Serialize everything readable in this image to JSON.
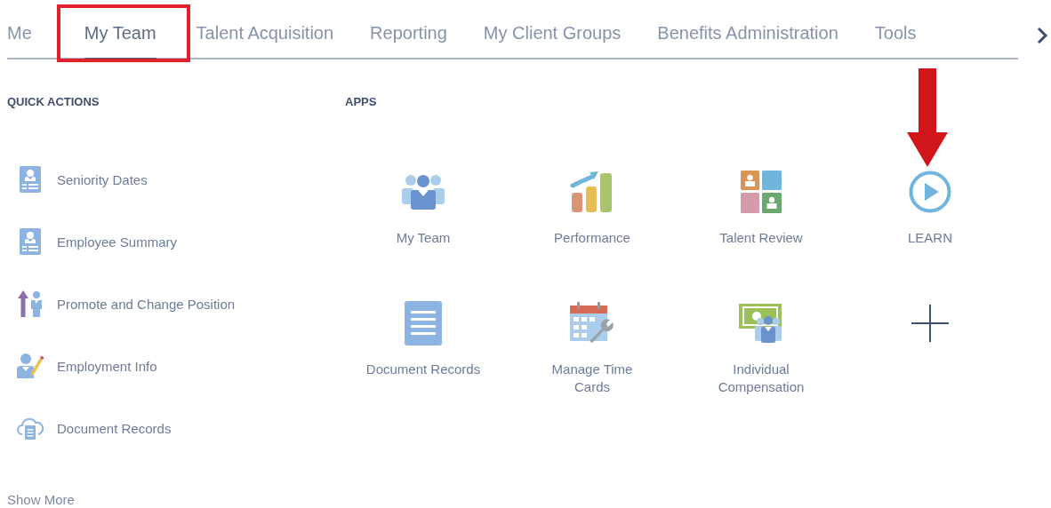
{
  "tabs": [
    {
      "label": "Me",
      "selected": false
    },
    {
      "label": "My Team",
      "selected": true
    },
    {
      "label": "Talent Acquisition",
      "selected": false
    },
    {
      "label": "Reporting",
      "selected": false
    },
    {
      "label": "My Client Groups",
      "selected": false
    },
    {
      "label": "Benefits Administration",
      "selected": false
    },
    {
      "label": "Tools",
      "selected": false
    }
  ],
  "quick_actions": {
    "title": "QUICK ACTIONS",
    "items": [
      {
        "label": "Seniority Dates",
        "kind": "badge"
      },
      {
        "label": "Employee Summary",
        "kind": "badge"
      },
      {
        "label": "Promote and Change Position",
        "kind": "promote"
      },
      {
        "label": "Employment Info",
        "kind": "edit-person"
      },
      {
        "label": "Document Records",
        "kind": "cloud-document"
      }
    ],
    "show_more": "Show More"
  },
  "apps": {
    "title": "APPS",
    "items": [
      {
        "label": "My Team",
        "kind": "team"
      },
      {
        "label": "Performance",
        "kind": "performance"
      },
      {
        "label": "Talent Review",
        "kind": "talent-review"
      },
      {
        "label": "LEARN",
        "kind": "learn"
      },
      {
        "label": "Document Records",
        "kind": "document"
      },
      {
        "label": "Manage Time Cards",
        "kind": "time-cards"
      },
      {
        "label": "Individual Compensation",
        "kind": "compensation"
      },
      {
        "kind": "add"
      }
    ]
  }
}
